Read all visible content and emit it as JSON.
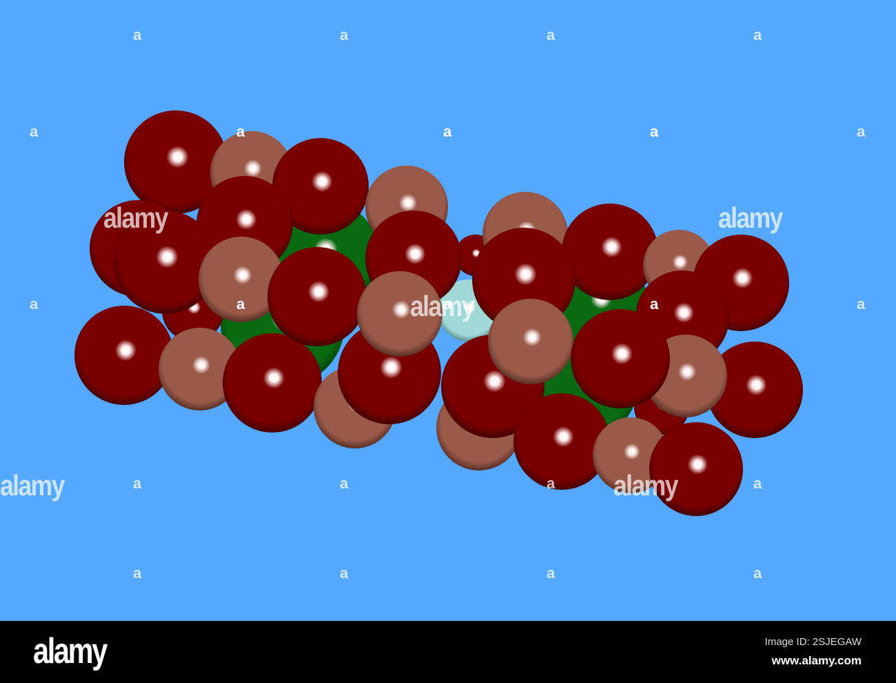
{
  "image": {
    "subject": "space-filling molecular model",
    "colors": {
      "background": "#55a8ff",
      "oxygen_red": "#7a0000",
      "carbon_brown": "#9a5a4a",
      "green_atom": "#0a6a10",
      "central_atom": "#a0d8d8"
    }
  },
  "watermark": {
    "mark": "a",
    "word": "alamy"
  },
  "footer": {
    "logo": "alamy",
    "image_id": "Image ID: 2SJEGAW",
    "url": "www.alamy.com"
  }
}
